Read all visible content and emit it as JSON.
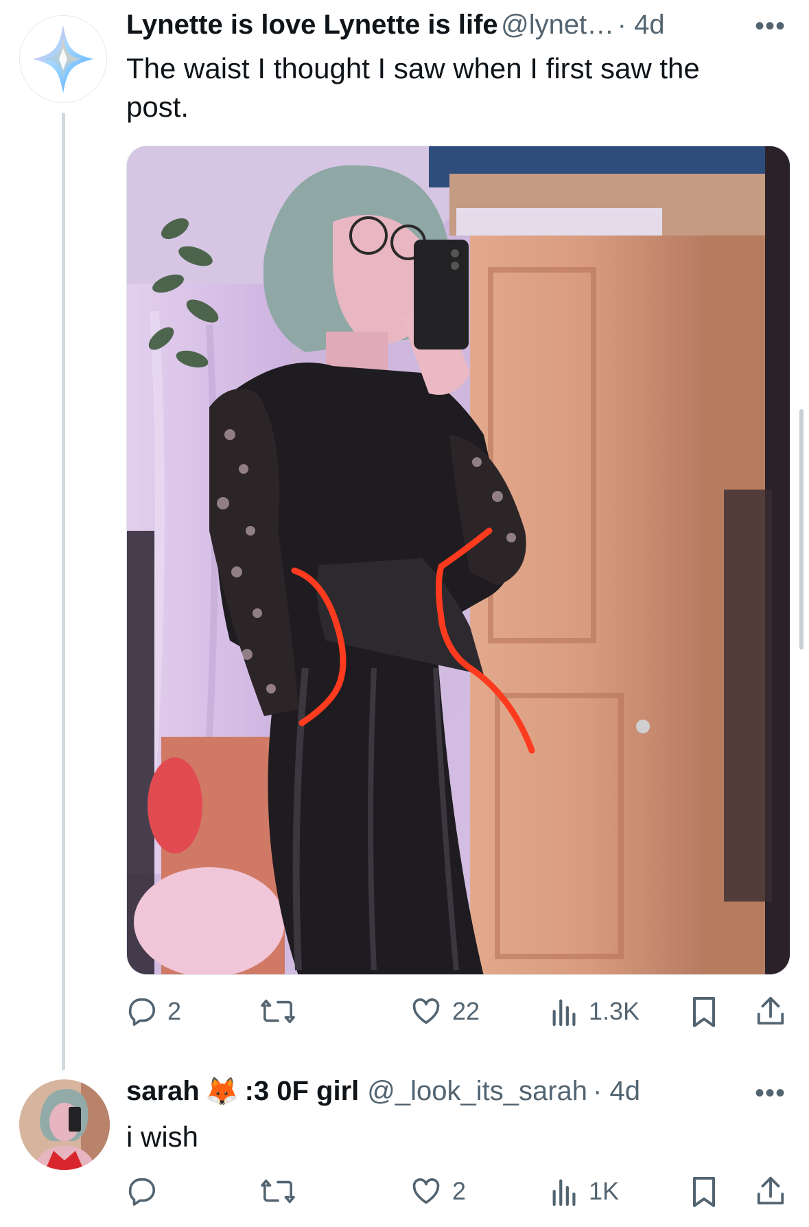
{
  "tweet1": {
    "display_name": "Lynette is love Lynette is life",
    "handle": "@lynet…",
    "time": "· 4d",
    "text": "The waist I thought I saw when I first saw the post.",
    "more": "•••",
    "stats": {
      "replies": "2",
      "likes": "22",
      "views": "1.3K"
    }
  },
  "tweet2": {
    "display_name": "sarah",
    "name_suffix": ":3 0F girl",
    "emoji": "🦊",
    "handle": "@_look_its_sarah",
    "time": "· 4d",
    "text": "i wish",
    "more": "•••",
    "stats": {
      "likes": "2",
      "views": "1K"
    }
  },
  "colors": {
    "text": "#0f1419",
    "secondary": "#536471",
    "annotation": "#ff3b1f"
  }
}
